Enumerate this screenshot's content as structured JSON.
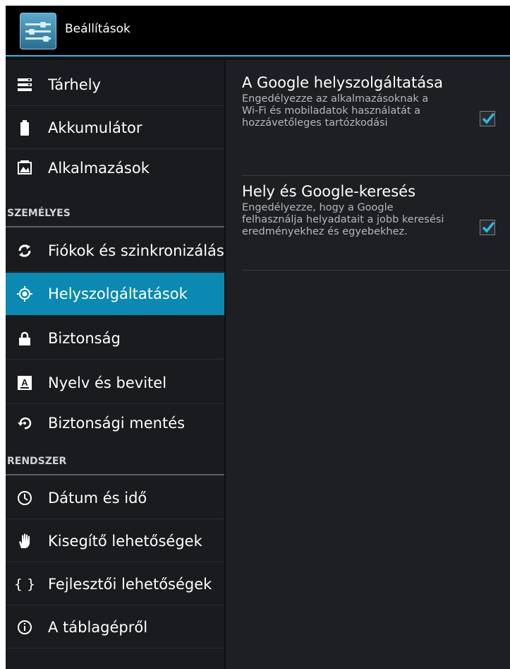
{
  "app": {
    "title": "Beállítások",
    "icon": "settings-sliders-icon"
  },
  "sidebar": {
    "items": [
      {
        "label": "Tárhely",
        "icon": "storage-icon",
        "active": false
      },
      {
        "label": "Akkumulátor",
        "icon": "battery-icon",
        "active": false
      },
      {
        "label": "Alkalmazások",
        "icon": "apps-icon",
        "active": false
      },
      {
        "label": "Fiókok és szinkronizálás",
        "icon": "sync-icon",
        "active": false
      },
      {
        "label": "Helyszolgáltatások",
        "icon": "location-icon",
        "active": true
      },
      {
        "label": "Biztonság",
        "icon": "lock-icon",
        "active": false
      },
      {
        "label": "Nyelv és bevitel",
        "icon": "keyboard-icon",
        "active": false
      },
      {
        "label": "Biztonsági mentés",
        "icon": "backup-icon",
        "active": false
      },
      {
        "label": "Dátum és idő",
        "icon": "clock-icon",
        "active": false
      },
      {
        "label": "Kisegítő lehetőségek",
        "icon": "accessibility-hand-icon",
        "active": false
      },
      {
        "label": "Fejlesztői lehetőségek",
        "icon": "braces-icon",
        "active": false
      },
      {
        "label": "A táblagépről",
        "icon": "info-icon",
        "active": false
      }
    ],
    "sections": {
      "personal": "SZEMÉLYES",
      "system": "RENDSZER"
    }
  },
  "detail": {
    "prefs": [
      {
        "title": "A Google helyszolgáltatása",
        "summary": "Engedélyezze az alkalmazásoknak a Wi-Fi és mobiladatok használatát a hozzávetőleges tartózkodási",
        "checked": true
      },
      {
        "title": "Hely és Google-keresés",
        "summary": "Engedélyezze, hogy a Google felhasználja helyadatait a jobb keresési eredményekhez és egyebekhez.",
        "checked": true
      }
    ]
  },
  "colors": {
    "accent": "#33b5e5",
    "active_item": "#0c89b2",
    "check": "#33b5e5"
  }
}
